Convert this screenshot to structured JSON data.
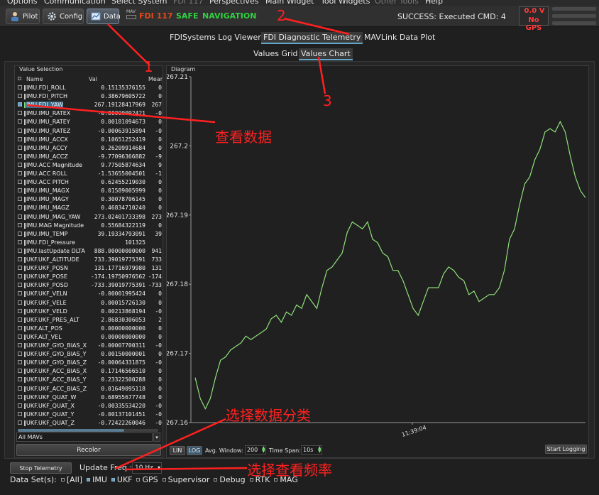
{
  "menu": [
    {
      "label": "Options",
      "dim": false
    },
    {
      "label": "Communication",
      "dim": false
    },
    {
      "label": "Select System",
      "dim": false
    },
    {
      "label": "FDI 117",
      "dim": true
    },
    {
      "label": "Perspectives",
      "dim": false
    },
    {
      "label": "Main Widget",
      "dim": false
    },
    {
      "label": "Tool Widgets",
      "dim": false
    },
    {
      "label": "Other Tools",
      "dim": true
    },
    {
      "label": "Help",
      "dim": false
    }
  ],
  "toolbar": {
    "pilot": "Pilot",
    "config": "Config",
    "data": "Data",
    "mav_small": "MAV",
    "fdi_name": "FDI 117",
    "safe": "SAFE",
    "navigation": "NAVIGATION",
    "success": "SUCCESS: Executed CMD: 4",
    "voltage": "0.0 V",
    "gps": "No GPS",
    "colors": {
      "fdi": "#e04a1c",
      "safe": "#30d040",
      "navigation": "#30d040"
    }
  },
  "tabs": {
    "main": [
      "FDISystems Log Viewer",
      "FDI Diagnostic Telemetry",
      "MAVLink Data Plot"
    ],
    "main_selected": 1,
    "sub": [
      "Values Grid",
      "Values Chart"
    ],
    "sub_selected": 1
  },
  "value_selection": {
    "title": "Value Selection",
    "columns": {
      "name": "Name",
      "val": "Val",
      "mean": "Mear"
    },
    "rows": [
      {
        "name": "IMU.FDI_ROLL",
        "val": "0.15135376155",
        "mean": "0",
        "checked": false,
        "selected": false
      },
      {
        "name": "IMU.FDI_PITCH",
        "val": "0.38679605722",
        "mean": "0",
        "checked": false,
        "selected": false
      },
      {
        "name": "IMU.FDI_YAW",
        "val": "267.19128417969",
        "mean": "267",
        "checked": true,
        "selected": true
      },
      {
        "name": "IMU.IMU_RATEX",
        "val": "-0.00000092421",
        "mean": "-0",
        "checked": false,
        "selected": false
      },
      {
        "name": "IMU.IMU_RATEY",
        "val": "0.00181094673",
        "mean": "0",
        "checked": false,
        "selected": false
      },
      {
        "name": "IMU.IMU_RATEZ",
        "val": "-0.00063915894",
        "mean": "-0",
        "checked": false,
        "selected": false
      },
      {
        "name": "IMU.IMU_ACCX",
        "val": "0.10651252419",
        "mean": "0",
        "checked": false,
        "selected": false
      },
      {
        "name": "IMU.IMU_ACCY",
        "val": "0.26209914684",
        "mean": "0",
        "checked": false,
        "selected": false
      },
      {
        "name": "IMU.IMU_ACCZ",
        "val": "-9.77096366882",
        "mean": "-9",
        "checked": false,
        "selected": false
      },
      {
        "name": "IMU.ACC Magnitude",
        "val": "9.77505874634",
        "mean": "9",
        "checked": false,
        "selected": false
      },
      {
        "name": "IMU.ACC ROLL",
        "val": "-1.53655004501",
        "mean": "-1",
        "checked": false,
        "selected": false
      },
      {
        "name": "IMU.ACC PITCH",
        "val": "0.62455219030",
        "mean": "0",
        "checked": false,
        "selected": false
      },
      {
        "name": "IMU.IMU_MAGX",
        "val": "0.01589005999",
        "mean": "0",
        "checked": false,
        "selected": false
      },
      {
        "name": "IMU.IMU_MAGY",
        "val": "0.30078706145",
        "mean": "0",
        "checked": false,
        "selected": false
      },
      {
        "name": "IMU.IMU_MAGZ",
        "val": "0.46834710240",
        "mean": "0",
        "checked": false,
        "selected": false
      },
      {
        "name": "IMU.IMU_MAG_YAW",
        "val": "273.02401733398",
        "mean": "273",
        "checked": false,
        "selected": false
      },
      {
        "name": "IMU.MAG Magnitude",
        "val": "0.55684322119",
        "mean": "0",
        "checked": false,
        "selected": false
      },
      {
        "name": "IMU.IMU_TEMP",
        "val": "39.19334793091",
        "mean": "39",
        "checked": false,
        "selected": false
      },
      {
        "name": "IMU.FDI_Pressure",
        "val": "101325",
        "mean": "",
        "checked": false,
        "selected": false
      },
      {
        "name": "IMU.lastUpdate DLTA",
        "val": "888.00000000000",
        "mean": "941",
        "checked": false,
        "selected": false
      },
      {
        "name": "UKF.UKF_ALTITUDE",
        "val": "733.39019775391",
        "mean": "733",
        "checked": false,
        "selected": false
      },
      {
        "name": "UKF.UKF_POSN",
        "val": "131.17716979980",
        "mean": "131",
        "checked": false,
        "selected": false
      },
      {
        "name": "UKF.UKF_POSE",
        "val": "-174.19750976562",
        "mean": "-174",
        "checked": false,
        "selected": false
      },
      {
        "name": "UKF.UKF_POSD",
        "val": "-733.39019775391",
        "mean": "-733",
        "checked": false,
        "selected": false
      },
      {
        "name": "UKF.UKF_VELN",
        "val": "-0.00001995424",
        "mean": "0",
        "checked": false,
        "selected": false
      },
      {
        "name": "UKF.UKF_VELE",
        "val": "0.00015726130",
        "mean": "0",
        "checked": false,
        "selected": false
      },
      {
        "name": "UKF.UKF_VELD",
        "val": "0.00213868194",
        "mean": "-0",
        "checked": false,
        "selected": false
      },
      {
        "name": "UKF.UKF_PRES_ALT",
        "val": "2.86830306053",
        "mean": "2",
        "checked": false,
        "selected": false
      },
      {
        "name": "UKF.ALT_POS",
        "val": "0.00000000000",
        "mean": "0",
        "checked": false,
        "selected": false
      },
      {
        "name": "UKF.ALT_VEL",
        "val": "0.00000000000",
        "mean": "0",
        "checked": false,
        "selected": false
      },
      {
        "name": "UKF.UKF_GYO_BIAS_X",
        "val": "-0.00007700311",
        "mean": "-0",
        "checked": false,
        "selected": false
      },
      {
        "name": "UKF.UKF_GYO_BIAS_Y",
        "val": "0.00150000001",
        "mean": "0",
        "checked": false,
        "selected": false
      },
      {
        "name": "UKF.UKF_GYO_BIAS_Z",
        "val": "-0.00064331875",
        "mean": "-0",
        "checked": false,
        "selected": false
      },
      {
        "name": "UKF.UKF_ACC_BIAS_X",
        "val": "0.17146566510",
        "mean": "0",
        "checked": false,
        "selected": false
      },
      {
        "name": "UKF.UKF_ACC_BIAS_Y",
        "val": "0.23322500288",
        "mean": "0",
        "checked": false,
        "selected": false
      },
      {
        "name": "UKF.UKF_ACC_BIAS_Z",
        "val": "0.01649095118",
        "mean": "0",
        "checked": false,
        "selected": false
      },
      {
        "name": "UKF.UKF_QUAT_W",
        "val": "0.68955677748",
        "mean": "0",
        "checked": false,
        "selected": false
      },
      {
        "name": "UKF.UKF_QUAT_X",
        "val": "-0.00335534220",
        "mean": "-0",
        "checked": false,
        "selected": false
      },
      {
        "name": "UKF.UKF_QUAT_Y",
        "val": "-0.00137101451",
        "mean": "-0",
        "checked": false,
        "selected": false
      },
      {
        "name": "UKF.UKF_QUAT_Z",
        "val": "-0.72422260046",
        "mean": "-0",
        "checked": false,
        "selected": false
      }
    ],
    "mav_select": "All MAVs",
    "recolor": "Recolor"
  },
  "diagram": {
    "title": "Diagram",
    "lin": "LIN",
    "log": "LOG",
    "avg_label": "Avg. Window:",
    "avg_value": "200",
    "span_label": "Time Span:",
    "span_value": "10s",
    "start_logging": "Start Logging",
    "line_color": "#8fe07a"
  },
  "chart_data": {
    "type": "line",
    "title": "",
    "xlabel": "",
    "ylabel": "",
    "ylim": [
      267.16,
      267.21
    ],
    "yticks": [
      "267.21",
      "267.2",
      "267.19",
      "267.18",
      "267.17",
      "267.16"
    ],
    "xtick_label": "11:39:04",
    "series": [
      {
        "values": [
          267.1665,
          267.1635,
          267.162,
          267.1635,
          267.1665,
          267.169,
          267.1695,
          267.1705,
          267.171,
          267.1715,
          267.1725,
          267.172,
          267.1725,
          267.173,
          267.1735,
          267.175,
          267.1755,
          267.1745,
          267.176,
          267.1755,
          267.177,
          267.1765,
          267.1785,
          267.1775,
          267.1765,
          267.1795,
          267.182,
          267.1825,
          267.1835,
          267.1845,
          267.1875,
          267.189,
          267.1885,
          267.188,
          267.189,
          267.1865,
          267.186,
          267.1845,
          267.184,
          267.182,
          267.182,
          267.1805,
          267.1785,
          267.1765,
          267.1755,
          267.1775,
          267.1795,
          267.1795,
          267.1795,
          267.1815,
          267.1825,
          267.182,
          267.181,
          267.1805,
          267.1785,
          267.179,
          267.1775,
          267.178,
          267.1785,
          267.1785,
          267.1795,
          267.182,
          267.1865,
          267.188,
          267.1915,
          267.1945,
          267.1955,
          267.198,
          267.1995,
          267.202,
          267.2025,
          267.202,
          267.2035,
          267.202,
          267.1985,
          267.1955,
          267.1935,
          267.1925
        ]
      }
    ]
  },
  "bottom": {
    "stop": "Stop Telemetry",
    "freq_label": "Update Freq.:",
    "freq_value": "10 Hz",
    "dataset_label": "Data Set(s):",
    "datasets": [
      {
        "label": "[All]",
        "on": false
      },
      {
        "label": "IMU",
        "on": true
      },
      {
        "label": "UKF",
        "on": true
      },
      {
        "label": "GPS",
        "on": false
      },
      {
        "label": "Supervisor",
        "on": false
      },
      {
        "label": "Debug",
        "on": false
      },
      {
        "label": "RTK",
        "on": false
      },
      {
        "label": "MAG",
        "on": false
      }
    ]
  },
  "annotations": {
    "n1": "1",
    "n2": "2",
    "n3": "3",
    "view_data": "查看数据",
    "select_category": "选择数据分类",
    "select_freq": "选择查看频率",
    "color": "#ff2020"
  }
}
